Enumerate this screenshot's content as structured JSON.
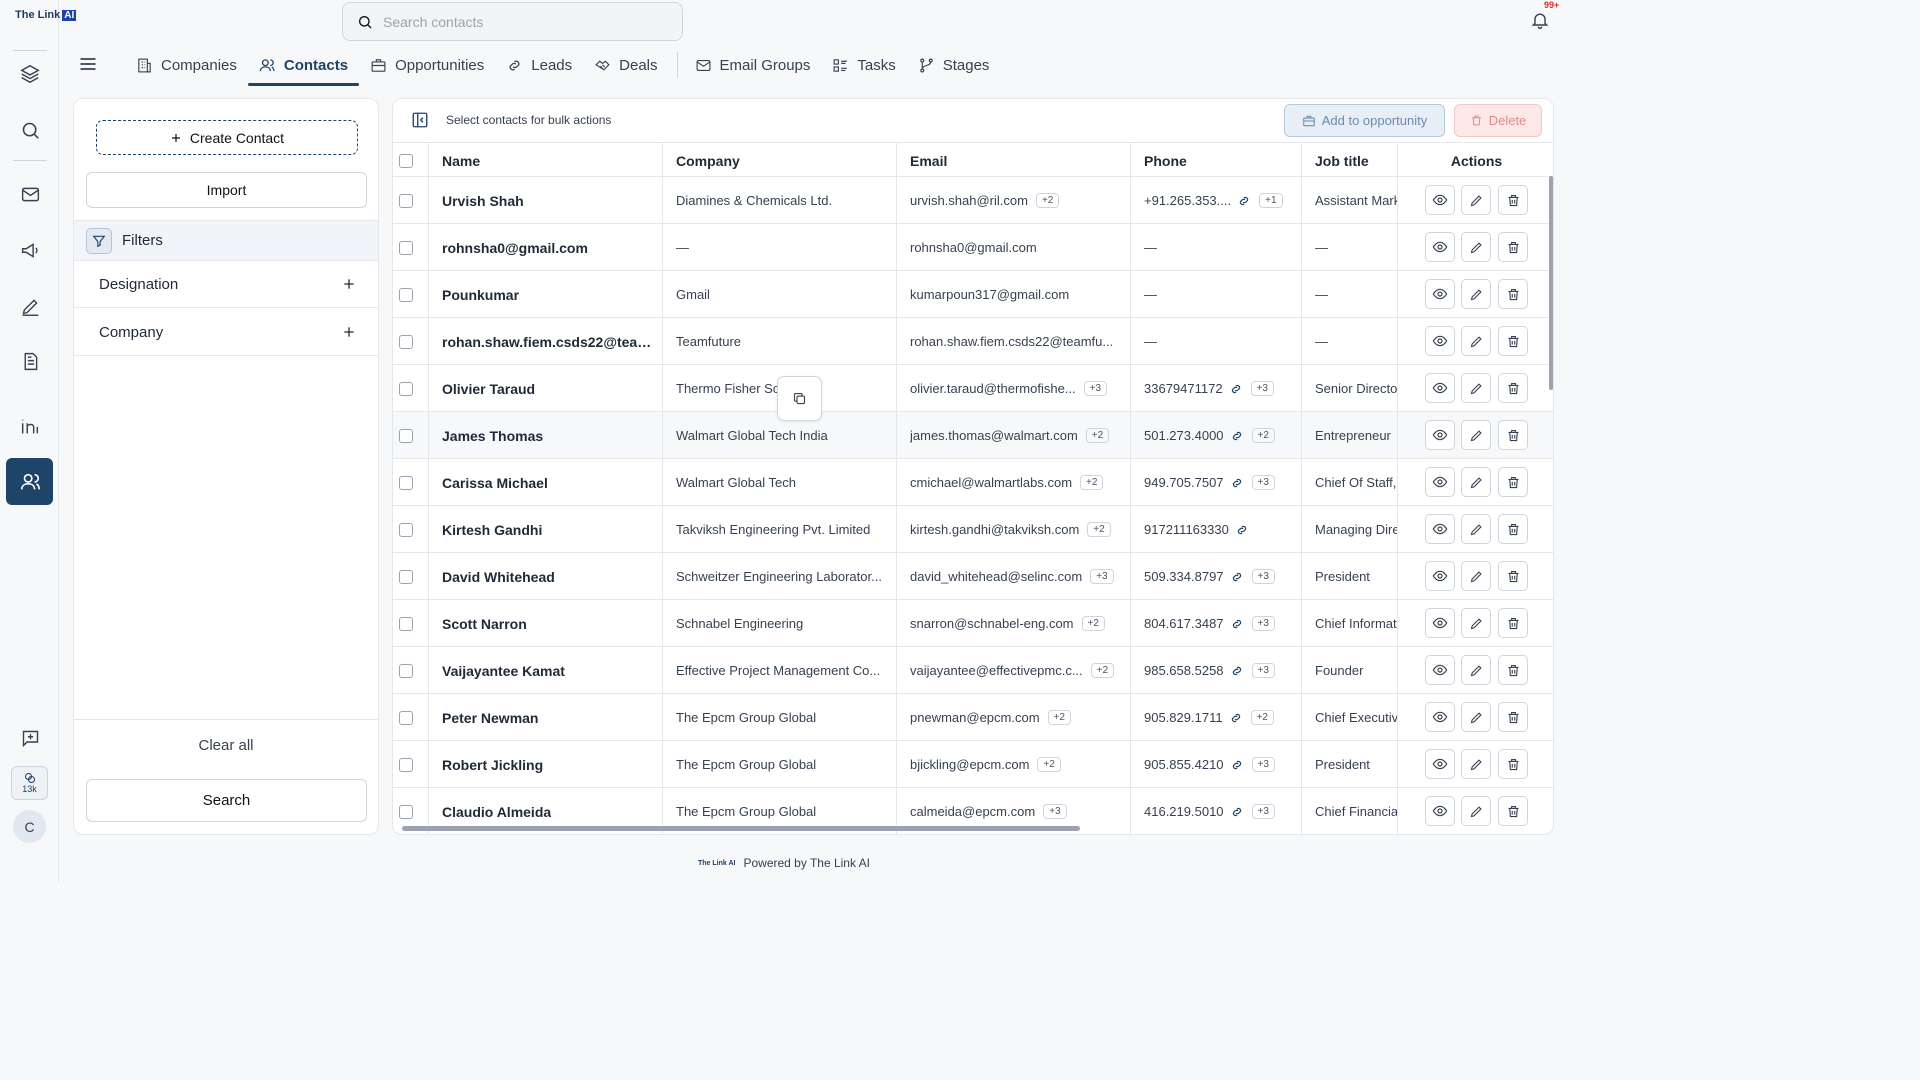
{
  "app": {
    "logo_text": "The Link",
    "logo_ai": "AI"
  },
  "search": {
    "placeholder": "Search contacts"
  },
  "notifications": {
    "badge": "99+"
  },
  "rail": {
    "credits": "13k",
    "avatar_initial": "C"
  },
  "tabs": [
    {
      "label": "Companies",
      "icon": "building-icon",
      "active": false
    },
    {
      "label": "Contacts",
      "icon": "users-icon",
      "active": true
    },
    {
      "label": "Opportunities",
      "icon": "briefcase-icon",
      "active": false
    },
    {
      "label": "Leads",
      "icon": "link-icon",
      "active": false
    },
    {
      "label": "Deals",
      "icon": "handshake-icon",
      "active": false
    },
    {
      "label": "Email Groups",
      "icon": "mail-icon",
      "active": false
    },
    {
      "label": "Tasks",
      "icon": "tasks-icon",
      "active": false
    },
    {
      "label": "Stages",
      "icon": "git-branch-icon",
      "active": false
    }
  ],
  "sidebar": {
    "create_label": "Create Contact",
    "import_label": "Import",
    "filters_label": "Filters",
    "filter_groups": [
      "Designation",
      "Company"
    ],
    "clear_all_label": "Clear all",
    "search_label": "Search"
  },
  "toolbar": {
    "bulk_text": "Select contacts for bulk actions",
    "add_opportunity_label": "Add to opportunity",
    "delete_label": "Delete"
  },
  "table": {
    "columns": [
      "Name",
      "Company",
      "Email",
      "Phone",
      "Job title",
      "Actions"
    ],
    "rows": [
      {
        "name": "Urvish Shah",
        "company": "Diamines & Chemicals Ltd.",
        "email": "urvish.shah@ril.com",
        "email_more": "+2",
        "phone": "+91.265.353....",
        "phone_link": true,
        "phone_more": "+1",
        "job": "Assistant Marke"
      },
      {
        "name": "rohnsha0@gmail.com",
        "company": "—",
        "email": "rohnsha0@gmail.com",
        "email_more": "",
        "phone": "—",
        "phone_link": false,
        "phone_more": "",
        "job": "—"
      },
      {
        "name": "Pounkumar",
        "company": "Gmail",
        "email": "kumarpoun317@gmail.com",
        "email_more": "",
        "phone": "—",
        "phone_link": false,
        "phone_more": "",
        "job": "—"
      },
      {
        "name": "rohan.shaw.fiem.csds22@teamf...",
        "company": "Teamfuture",
        "email": "rohan.shaw.fiem.csds22@teamfu...",
        "email_more": "",
        "phone": "—",
        "phone_link": false,
        "phone_more": "",
        "job": "—"
      },
      {
        "name": "Olivier Taraud",
        "company": "Thermo Fisher Sci",
        "email": "olivier.taraud@thermofishe...",
        "email_more": "+3",
        "phone": "33679471172",
        "phone_link": true,
        "phone_more": "+3",
        "job": "Senior Director"
      },
      {
        "name": "James Thomas",
        "company": "Walmart Global Tech India",
        "email": "james.thomas@walmart.com",
        "email_more": "+2",
        "phone": "501.273.4000",
        "phone_link": true,
        "phone_more": "+2",
        "job": "Entrepreneur"
      },
      {
        "name": "Carissa Michael",
        "company": "Walmart Global Tech",
        "email": "cmichael@walmartlabs.com",
        "email_more": "+2",
        "phone": "949.705.7507",
        "phone_link": true,
        "phone_more": "+3",
        "job": "Chief Of Staff, I"
      },
      {
        "name": "Kirtesh Gandhi",
        "company": "Takviksh Engineering Pvt. Limited",
        "email": "kirtesh.gandhi@takviksh.com",
        "email_more": "+2",
        "phone": "917211163330",
        "phone_link": true,
        "phone_more": "",
        "job": "Managing Direc"
      },
      {
        "name": "David Whitehead",
        "company": "Schweitzer Engineering Laborator...",
        "email": "david_whitehead@selinc.com",
        "email_more": "+3",
        "phone": "509.334.8797",
        "phone_link": true,
        "phone_more": "+3",
        "job": "President"
      },
      {
        "name": "Scott Narron",
        "company": "Schnabel Engineering",
        "email": "snarron@schnabel-eng.com",
        "email_more": "+2",
        "phone": "804.617.3487",
        "phone_link": true,
        "phone_more": "+3",
        "job": "Chief Informati"
      },
      {
        "name": "Vaijayantee Kamat",
        "company": "Effective Project Management Co...",
        "email": "vaijayantee@effectivepmc.c...",
        "email_more": "+2",
        "phone": "985.658.5258",
        "phone_link": true,
        "phone_more": "+3",
        "job": "Founder"
      },
      {
        "name": "Peter Newman",
        "company": "The Epcm Group Global",
        "email": "pnewman@epcm.com",
        "email_more": "+2",
        "phone": "905.829.1711",
        "phone_link": true,
        "phone_more": "+2",
        "job": "Chief Executive"
      },
      {
        "name": "Robert Jickling",
        "company": "The Epcm Group Global",
        "email": "bjickling@epcm.com",
        "email_more": "+2",
        "phone": "905.855.4210",
        "phone_link": true,
        "phone_more": "+3",
        "job": "President"
      },
      {
        "name": "Claudio Almeida",
        "company": "The Epcm Group Global",
        "email": "calmeida@epcm.com",
        "email_more": "+3",
        "phone": "416.219.5010",
        "phone_link": true,
        "phone_more": "+3",
        "job": "Chief Financial"
      }
    ]
  },
  "footer": {
    "text": "Powered by The Link AI",
    "mini_logo": "The Link AI"
  }
}
